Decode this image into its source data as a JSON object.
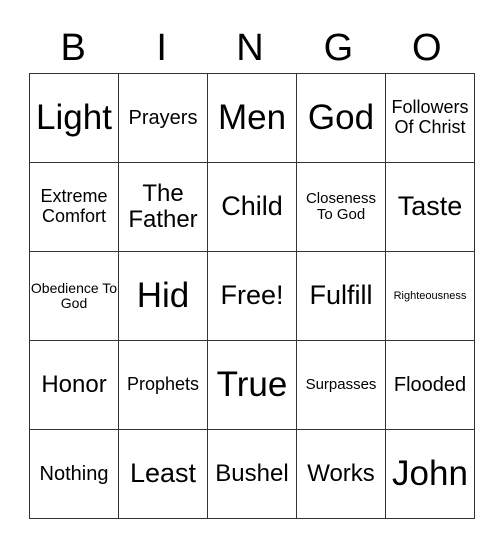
{
  "header": [
    "B",
    "I",
    "N",
    "G",
    "O"
  ],
  "rows": [
    [
      "Light",
      "Prayers",
      "Men",
      "God",
      "Followers Of Christ"
    ],
    [
      "Extreme Comfort",
      "The Father",
      "Child",
      "Closeness To God",
      "Taste"
    ],
    [
      "Obedience To God",
      "Hid",
      "Free!",
      "Fulfill",
      "Righteousness"
    ],
    [
      "Honor",
      "Prophets",
      "True",
      "Surpasses",
      "Flooded"
    ],
    [
      "Nothing",
      "Least",
      "Bushel",
      "Works",
      "John"
    ]
  ]
}
